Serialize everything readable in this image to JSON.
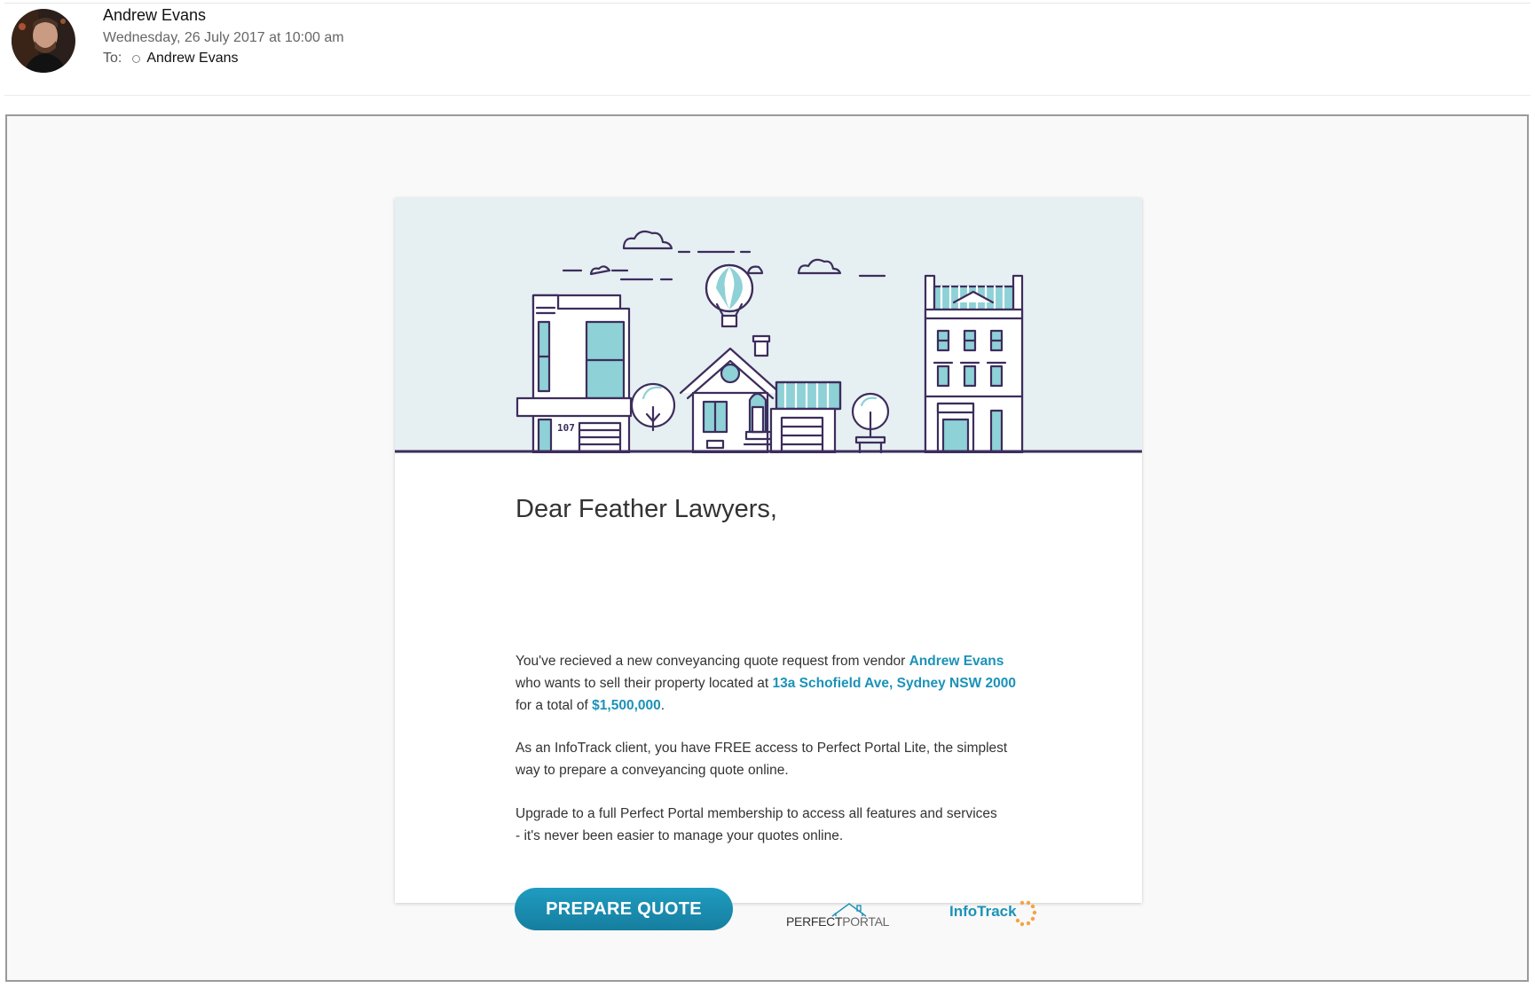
{
  "header": {
    "sender_name": "Andrew Evans",
    "date": "Wednesday, 26 July 2017 at 10:00 am",
    "to_label": "To:",
    "recipient": "Andrew Evans"
  },
  "email": {
    "hero_illustration": "house-street-illustration",
    "house_number": "107",
    "greeting": "Dear Feather Lawyers,",
    "paragraph1": {
      "line1_text": "You've recieved a new conveyancing quote request from vendor ",
      "vendor_name": "Andrew Evans",
      "line2_text": "who wants to sell their property located at ",
      "address": "13a Schofield Ave, Sydney NSW 2000",
      "line3_text": "for a total of ",
      "amount": "$1,500,000",
      "line3_end": "."
    },
    "paragraph2": {
      "line1": "As an InfoTrack client, you have FREE access to Perfect Portal Lite, the simplest",
      "line2": "way to prepare a conveyancing quote online."
    },
    "paragraph3": {
      "line1": "Upgrade to a full Perfect Portal membership to access all features and services",
      "line2": "- it's never been easier to manage your quotes online."
    },
    "cta_label": "PREPARE QUOTE",
    "perfect_portal_logo": {
      "part1": "PERFECT",
      "part2": "PORTAL"
    },
    "infotrack_logo": "InfoTrack"
  },
  "colors": {
    "accent": "#1b92b8",
    "hero_background": "#e6eff2",
    "illustration_line": "#3d2d5c",
    "illustration_fill": "#8ed1d6",
    "infotrack_dots": "#f5a243"
  }
}
